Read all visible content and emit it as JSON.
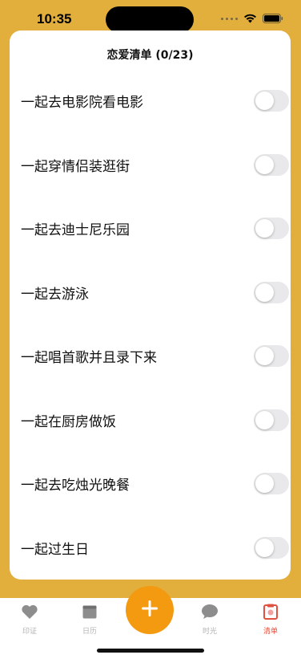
{
  "status_bar": {
    "time": "10:35"
  },
  "page": {
    "title": "恋爱清单 (0/23)"
  },
  "items": [
    {
      "label": "一起去电影院看电影",
      "checked": false
    },
    {
      "label": "一起穿情侣装逛街",
      "checked": false
    },
    {
      "label": "一起去迪士尼乐园",
      "checked": false
    },
    {
      "label": "一起去游泳",
      "checked": false
    },
    {
      "label": "一起唱首歌并且录下来",
      "checked": false
    },
    {
      "label": "一起在厨房做饭",
      "checked": false
    },
    {
      "label": "一起去吃烛光晚餐",
      "checked": false
    },
    {
      "label": "一起过生日",
      "checked": false
    }
  ],
  "tabbar": {
    "tabs": [
      {
        "label": "印证",
        "icon": "heart-icon",
        "active": false
      },
      {
        "label": "日历",
        "icon": "calendar-icon",
        "active": false
      },
      {
        "label": "时光",
        "icon": "bubble-icon",
        "active": false
      },
      {
        "label": "清单",
        "icon": "checklist-icon",
        "active": true
      }
    ],
    "fab_icon": "plus-icon"
  },
  "colors": {
    "background": "#e2ae3c",
    "fab": "#f39a11",
    "active_tab": "#e0513f"
  }
}
